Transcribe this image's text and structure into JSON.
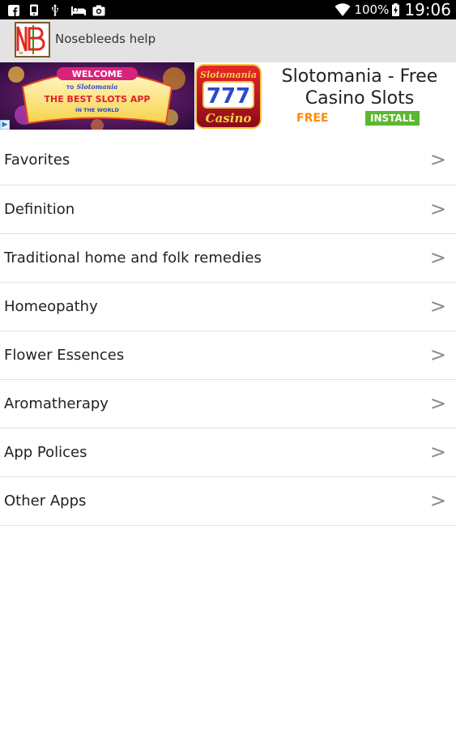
{
  "status_bar": {
    "icons": [
      "facebook-icon",
      "screenshot-icon",
      "usb-icon",
      "bed-icon",
      "photo-icon"
    ],
    "battery_percent": "100%",
    "time": "19:06"
  },
  "app_bar": {
    "logo_text": "NB",
    "title": "Nosebleeds help"
  },
  "ad": {
    "banner_text": {
      "welcome": "WELCOME",
      "to": "TO",
      "brand": "Slotomania",
      "headline": "THE BEST SLOTS APP",
      "subline": "IN THE WORLD"
    },
    "app_icon_text": {
      "brand": "Slotomania",
      "reels": "777",
      "label": "Casino"
    },
    "title_line1": "Slotomania - Free",
    "title_line2": "Casino Slots",
    "price": "FREE",
    "install_label": "INSTALL",
    "choices_icon": "adchoices-icon"
  },
  "menu": {
    "items": [
      {
        "label": "Favorites",
        "chevron": ">"
      },
      {
        "label": "Definition",
        "chevron": ">"
      },
      {
        "label": "Traditional home and folk remedies",
        "chevron": ">"
      },
      {
        "label": "Homeopathy",
        "chevron": ">"
      },
      {
        "label": "Flower Essences",
        "chevron": ">"
      },
      {
        "label": "Aromatherapy",
        "chevron": ">"
      },
      {
        "label": "App Polices",
        "chevron": ">"
      },
      {
        "label": "Other Apps",
        "chevron": ">"
      }
    ]
  },
  "colors": {
    "status_bar_bg": "#000000",
    "action_bar_bg": "#e3e3e3",
    "ad_free": "#ff8a00",
    "ad_install": "#5cb82e",
    "chevron": "#8a8a8a"
  }
}
